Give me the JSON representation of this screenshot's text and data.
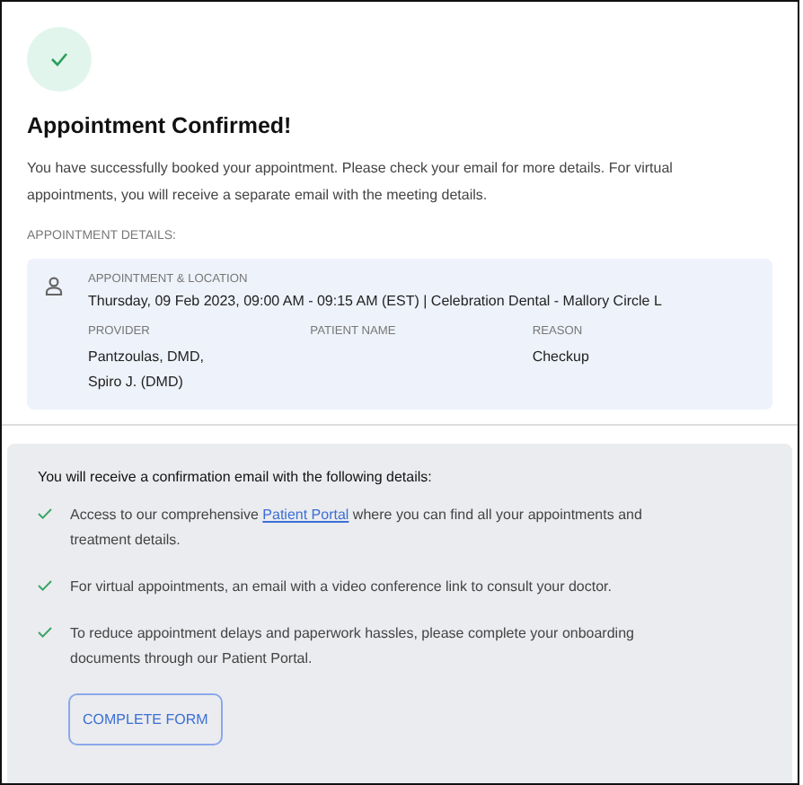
{
  "title": "Appointment Confirmed!",
  "message": "You have successfully booked your appointment. Please check your email for more details. For virtual appointments, you will receive a separate email with the meeting details.",
  "details_heading": "APPOINTMENT DETAILS:",
  "appointment": {
    "label": "APPOINTMENT & LOCATION",
    "value": "Thursday, 09 Feb 2023, 09:00 AM - 09:15 AM (EST) | Celebration Dental - Mallory Circle L",
    "fields": [
      {
        "label": "PROVIDER",
        "lines": [
          "Pantzoulas, DMD,",
          "Spiro J. (DMD)"
        ]
      },
      {
        "label": "PATIENT NAME"
      },
      {
        "label": "REASON",
        "lines": [
          "Checkup"
        ]
      }
    ]
  },
  "email_heading": "You will receive a confirmation email with the following details:",
  "email_items": [
    {
      "before": "Access to our comprehensive ",
      "link": "Patient Portal",
      "after": " where you can find all your appointments and treatment details."
    },
    {
      "before": "For virtual appointments, an email with a video conference link to consult your doctor."
    },
    {
      "before": "To reduce appointment delays and paperwork hassles, please complete your onboarding documents through our Patient Portal."
    }
  ],
  "button": "COMPLETE FORM"
}
